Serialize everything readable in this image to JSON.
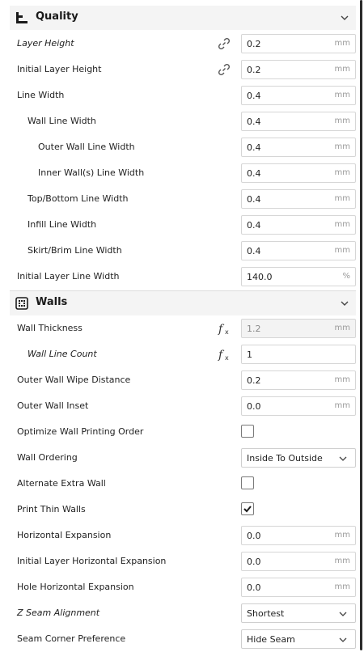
{
  "colors": {
    "accent": "#1f1f1f",
    "header_bg": "#f4f4f4",
    "field_border": "#d6d6d6"
  },
  "sections": {
    "quality": {
      "title": "Quality",
      "icon": "quality-bars-icon"
    },
    "walls": {
      "title": "Walls",
      "icon": "walls-grid-icon"
    }
  },
  "quality": {
    "layer_height": {
      "label": "Layer Height",
      "value": "0.2",
      "unit": "mm"
    },
    "initial_layer_height": {
      "label": "Initial Layer Height",
      "value": "0.2",
      "unit": "mm"
    },
    "line_width": {
      "label": "Line Width",
      "value": "0.4",
      "unit": "mm"
    },
    "wall_line_width": {
      "label": "Wall Line Width",
      "value": "0.4",
      "unit": "mm"
    },
    "outer_wall_line_width": {
      "label": "Outer Wall Line Width",
      "value": "0.4",
      "unit": "mm"
    },
    "inner_wall_line_width": {
      "label": "Inner Wall(s) Line Width",
      "value": "0.4",
      "unit": "mm"
    },
    "top_bottom_line_width": {
      "label": "Top/Bottom Line Width",
      "value": "0.4",
      "unit": "mm"
    },
    "infill_line_width": {
      "label": "Infill Line Width",
      "value": "0.4",
      "unit": "mm"
    },
    "skirt_brim_line_width": {
      "label": "Skirt/Brim Line Width",
      "value": "0.4",
      "unit": "mm"
    },
    "initial_layer_line_width": {
      "label": "Initial Layer Line Width",
      "value": "140.0",
      "unit": "%"
    }
  },
  "walls": {
    "wall_thickness": {
      "label": "Wall Thickness",
      "value": "1.2",
      "unit": "mm"
    },
    "wall_line_count": {
      "label": "Wall Line Count",
      "value": "1"
    },
    "outer_wall_wipe_distance": {
      "label": "Outer Wall Wipe Distance",
      "value": "0.2",
      "unit": "mm"
    },
    "outer_wall_inset": {
      "label": "Outer Wall Inset",
      "value": "0.0",
      "unit": "mm"
    },
    "optimize_wall_printing_order": {
      "label": "Optimize Wall Printing Order",
      "checked": false
    },
    "wall_ordering": {
      "label": "Wall Ordering",
      "value": "Inside To Outside"
    },
    "alternate_extra_wall": {
      "label": "Alternate Extra Wall",
      "checked": false
    },
    "print_thin_walls": {
      "label": "Print Thin Walls",
      "checked": true
    },
    "horizontal_expansion": {
      "label": "Horizontal Expansion",
      "value": "0.0",
      "unit": "mm"
    },
    "initial_layer_horizontal_expansion": {
      "label": "Initial Layer Horizontal Expansion",
      "value": "0.0",
      "unit": "mm"
    },
    "hole_horizontal_expansion": {
      "label": "Hole Horizontal Expansion",
      "value": "0.0",
      "unit": "mm"
    },
    "z_seam_alignment": {
      "label": "Z Seam Alignment",
      "value": "Shortest"
    },
    "seam_corner_preference": {
      "label": "Seam Corner Preference",
      "value": "Hide Seam"
    }
  }
}
